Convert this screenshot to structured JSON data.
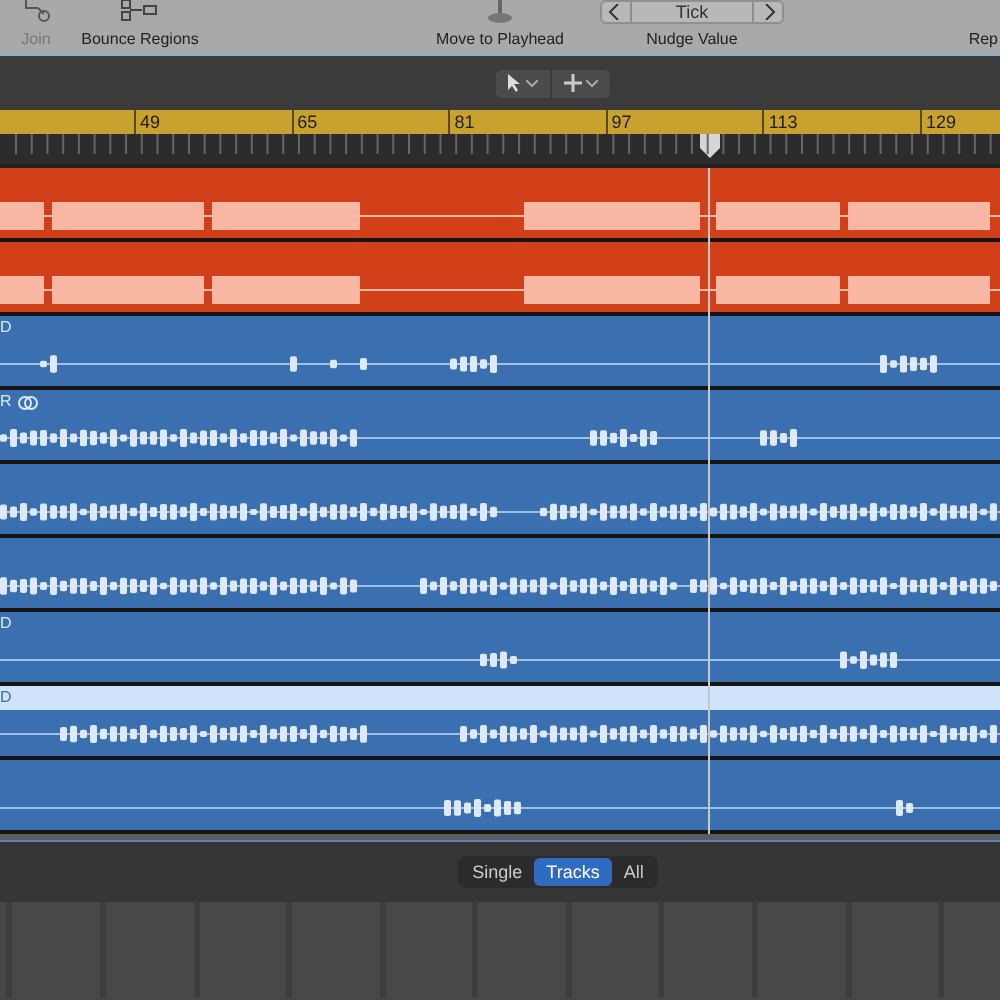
{
  "toolbar": {
    "buttons": [
      {
        "label": "Join",
        "disabled": true,
        "kind": "join"
      },
      {
        "label": "Bounce Regions",
        "disabled": false,
        "kind": "bounce"
      },
      {
        "label": "Move to Playhead",
        "disabled": false,
        "kind": "playhead"
      }
    ],
    "nudge": {
      "value": "Tick",
      "label": "Nudge Value"
    },
    "cut_label": "Rep"
  },
  "ruler": {
    "bars": [
      "49",
      "65",
      "81",
      "97",
      "113",
      "129"
    ]
  },
  "tracks": [
    {
      "color": "#d2401a",
      "selected": false
    },
    {
      "color": "#d2401a",
      "selected": false
    },
    {
      "label": "D",
      "color": "#3a6fb0",
      "selected": false
    },
    {
      "label": "R",
      "color": "#3a6fb0",
      "selected": false,
      "looped": true
    },
    {
      "color": "#3a6fb0",
      "selected": false
    },
    {
      "color": "#3a6fb0",
      "selected": false
    },
    {
      "label": "D",
      "color": "#3a6fb0",
      "selected": false
    },
    {
      "label": "D",
      "color": "#3a6fb0",
      "selected": true
    },
    {
      "color": "#3a6fb0",
      "selected": false
    }
  ],
  "view_switch": [
    {
      "label": "Single",
      "selected": false
    },
    {
      "label": "Tracks",
      "selected": true
    },
    {
      "label": "All",
      "selected": false
    }
  ]
}
